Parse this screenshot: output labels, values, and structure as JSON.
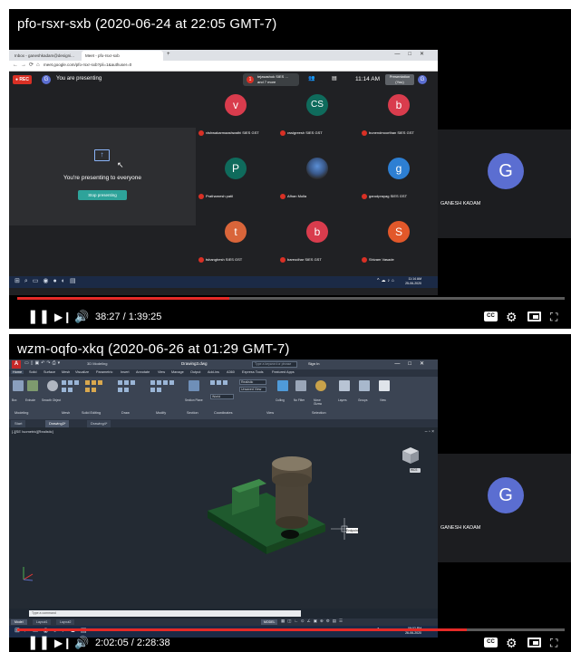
{
  "panel1": {
    "title": "pfo-rsxr-sxb (2020-06-24 at 22:05 GMT-7)",
    "browser": {
      "tabs": [
        "Inbox - ganeshkadam@designi...",
        "Meet - pfo-rsxr-sxb"
      ],
      "url": "meet.google.com/pfo-rsxr-sxb?pli=1&authuser=0"
    },
    "meet": {
      "rec_label": "● REC",
      "presenter_initial": "G",
      "presenting_label": "You are presenting",
      "raise_badge": "1",
      "raise_line1": "tejasashok SIES ...",
      "raise_line2": "and 7 more",
      "clock": "11:14 AM",
      "present_chip": "Presentation (You)",
      "me_initial": "G",
      "presenting_msg": "You're presenting to everyone",
      "stop_button": "Stop presenting"
    },
    "grid": [
      {
        "initial": "v",
        "name": "vishwakarmaashwathi SIES GST",
        "color": "#d93c4d"
      },
      {
        "initial": "CS",
        "name": "cssigreesh SIES GST",
        "color": "#0f6b5c"
      },
      {
        "initial": "b",
        "name": "bunendmoorthan SIES GST",
        "color": "#d93c4d"
      },
      {
        "initial": "P",
        "name": "Prathamesh patil",
        "color": "#0f6b5c"
      },
      {
        "initial": "",
        "name": "Afhan Mulla",
        "color": "#6b5a4a"
      },
      {
        "initial": "g",
        "name": "garudprayag SIES GST",
        "color": "#2d7fd3"
      },
      {
        "initial": "t",
        "name": "tshanghesh SIES GST",
        "color": "#d9653a"
      },
      {
        "initial": "b",
        "name": "bareodhar SIES GST",
        "color": "#d93c4d"
      },
      {
        "initial": "S",
        "name": "Shivam Vasade",
        "color": "#e2582a"
      }
    ],
    "taskbar": {
      "tray_time": "11:14 AM",
      "tray_date": "25-06-2020",
      "tray_lang": "ENG"
    },
    "participant": {
      "initial": "G",
      "name": "GANESH KADAM"
    },
    "player": {
      "time": "38:27 / 1:39:25",
      "progress": 0.387
    }
  },
  "panel2": {
    "title": "wzm-oqfo-xkq (2020-06-26 at 01:29 GMT-7)",
    "acad": {
      "logo": "A",
      "workspace": "3D Modeling",
      "filename": "Drawing3.dwg",
      "search_placeholder": "Type a keyword or phrase",
      "signin": "Sign In",
      "menus": [
        "Home",
        "Solid",
        "Surface",
        "Mesh",
        "Visualize",
        "Parametric",
        "Insert",
        "Annotate",
        "View",
        "Manage",
        "Output",
        "Add-ins",
        "A360",
        "Express Tools",
        "Featured Apps"
      ],
      "ribbon_groups": [
        "Modeling",
        "Mesh",
        "Solid Editing",
        "Draw",
        "Modify",
        "Section",
        "Coordinates",
        "View",
        "Selection"
      ],
      "ribbon_labels": {
        "box": "Box",
        "extrude": "Extrude",
        "smooth_object": "Smooth Object",
        "section_plane": "Section Plane",
        "culling": "Culling",
        "no_filter": "No Filter",
        "move_gizmo": "Move Gizmo",
        "layers": "Layers",
        "groups": "Groups",
        "view": "View"
      },
      "combos": {
        "visual_style": "Realistic",
        "view_style": "Unsaved View",
        "ucs": "World"
      },
      "file_tabs": [
        "Start",
        "Drawing3*",
        "Drawing4*"
      ],
      "viewport_label": "[-][SE Isometric][Realistic]",
      "wcs": "WCS",
      "osnap_tip": "Endpoint",
      "cmd_placeholder": "Type a command",
      "layout_tabs": [
        "Model",
        "Layout1",
        "Layout2"
      ],
      "model_button": "MODEL"
    },
    "taskbar": {
      "tray_time": "09:02 PM",
      "tray_date": "26-06-2020",
      "tray_lang": "ENG"
    },
    "participant": {
      "initial": "G",
      "name": "GANESH KADAM"
    },
    "player": {
      "time": "2:02:05 / 2:28:38",
      "progress": 0.822
    }
  },
  "icons": {
    "play": "play-icon",
    "next": "next-icon",
    "volume": "volume-icon",
    "cc": "cc-icon",
    "settings": "gear-icon",
    "miniplayer": "miniplayer-icon",
    "fullscreen": "exit-fullscreen-icon"
  },
  "cc_label": "CC"
}
